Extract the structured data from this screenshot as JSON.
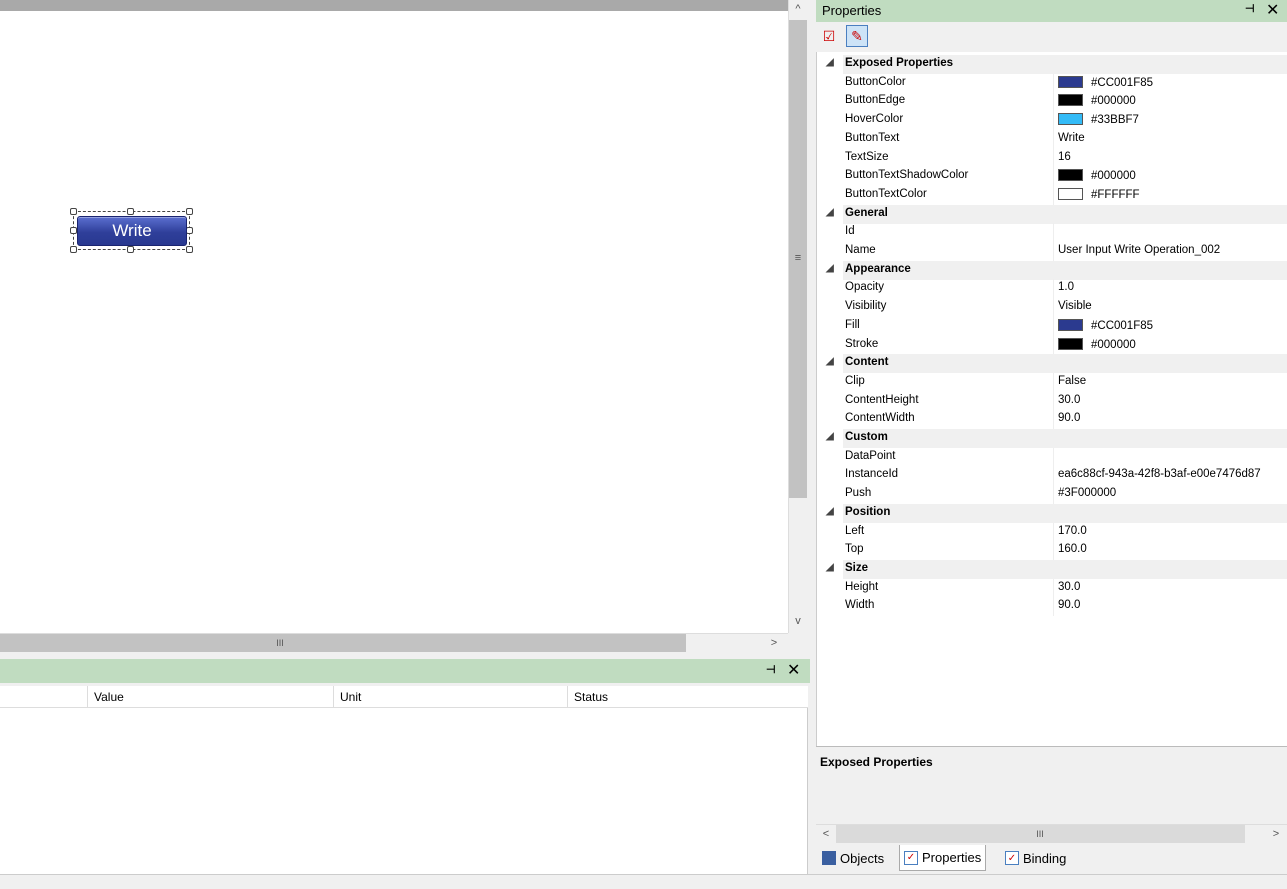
{
  "canvas": {
    "button_text": "Write"
  },
  "canvas_hscroll": {
    "thumb_grip": "III",
    "right_arrow": ">"
  },
  "canvas_vscroll": {
    "up_arrow": "^",
    "down_arrow": "v",
    "grip": "≡"
  },
  "bottom_panel": {
    "pin_icon": "pin-icon",
    "columns": [
      "Value",
      "Unit",
      "Status"
    ]
  },
  "properties": {
    "title": "Properties",
    "rows": [
      {
        "type": "category",
        "name": "Exposed Properties"
      },
      {
        "type": "prop",
        "name": "ButtonColor",
        "value": "#CC001F85",
        "swatch": "#2b3a8f"
      },
      {
        "type": "prop",
        "name": "ButtonEdge",
        "value": "#000000",
        "swatch": "#000000"
      },
      {
        "type": "prop",
        "name": "HoverColor",
        "value": "#33BBF7",
        "swatch": "#33bbf7"
      },
      {
        "type": "prop",
        "name": "ButtonText",
        "value": "Write"
      },
      {
        "type": "prop",
        "name": "TextSize",
        "value": "16"
      },
      {
        "type": "prop",
        "name": "ButtonTextShadowColor",
        "value": "#000000",
        "swatch": "#000000"
      },
      {
        "type": "prop",
        "name": "ButtonTextColor",
        "value": "#FFFFFF",
        "swatch": "#ffffff"
      },
      {
        "type": "category",
        "name": "General"
      },
      {
        "type": "prop",
        "name": "Id",
        "value": ""
      },
      {
        "type": "prop",
        "name": "Name",
        "value": "User Input Write Operation_002"
      },
      {
        "type": "category",
        "name": "Appearance"
      },
      {
        "type": "prop",
        "name": "Opacity",
        "value": "1.0"
      },
      {
        "type": "prop",
        "name": "Visibility",
        "value": "Visible"
      },
      {
        "type": "prop",
        "name": "Fill",
        "value": "#CC001F85",
        "swatch": "#2b3a8f"
      },
      {
        "type": "prop",
        "name": "Stroke",
        "value": "#000000",
        "swatch": "#000000"
      },
      {
        "type": "category",
        "name": "Content"
      },
      {
        "type": "prop",
        "name": "Clip",
        "value": "False"
      },
      {
        "type": "prop",
        "name": "ContentHeight",
        "value": "30.0"
      },
      {
        "type": "prop",
        "name": "ContentWidth",
        "value": "90.0"
      },
      {
        "type": "category",
        "name": "Custom"
      },
      {
        "type": "prop",
        "name": "DataPoint",
        "value": ""
      },
      {
        "type": "prop",
        "name": "InstanceId",
        "value": "ea6c88cf-943a-42f8-b3af-e00e7476d87"
      },
      {
        "type": "prop",
        "name": "Push",
        "value": "#3F000000"
      },
      {
        "type": "category",
        "name": "Position"
      },
      {
        "type": "prop",
        "name": "Left",
        "value": "170.0"
      },
      {
        "type": "prop",
        "name": "Top",
        "value": "160.0"
      },
      {
        "type": "category",
        "name": "Size"
      },
      {
        "type": "prop",
        "name": "Height",
        "value": "30.0"
      },
      {
        "type": "prop",
        "name": "Width",
        "value": "90.0"
      }
    ],
    "description_title": "Exposed Properties",
    "hscroll_left": "<",
    "hscroll_right": ">",
    "hscroll_grip": "III"
  },
  "tabs": [
    {
      "label": "Objects",
      "icon": "objects-icon"
    },
    {
      "label": "Properties",
      "icon": "properties-icon"
    },
    {
      "label": "Binding",
      "icon": "binding-icon"
    }
  ]
}
